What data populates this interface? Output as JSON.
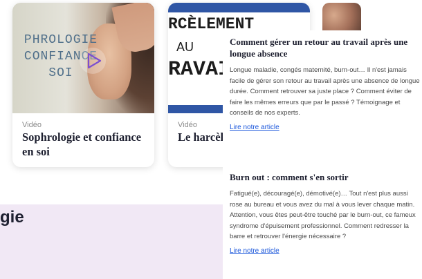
{
  "section": {
    "heading_fragment": "gie"
  },
  "cards": [
    {
      "thumbnail_text_lines": [
        "PHROLOGIE",
        "CONFIANCE",
        "SOI"
      ],
      "type": "Vidéo",
      "title": "Sophrologie et confiance en soi"
    },
    {
      "thumbnail_text_lines": [
        "RCÈLEMENT",
        "AU",
        "RAVAIL"
      ],
      "type": "Vidéo",
      "title": "Le harcèlement au travail"
    }
  ],
  "articles": [
    {
      "title": "Comment gérer un retour au travail après une longue absence",
      "body": "Longue maladie, congés maternité, burn-out… Il n'est jamais facile de gérer son retour au travail après une absence de longue durée. Comment retrouver sa juste place ? Comment éviter de faire les mêmes erreurs que par le passé ? Témoignage et conseils de nos experts.",
      "link": "Lire notre article"
    },
    {
      "title": "Burn out : comment s'en sortir",
      "body": "Fatigué(e), découragé(e), démotivé(e)… Tout n'est plus aussi rose au bureau et vous avez du mal à vous lever chaque matin. Attention, vous êtes peut-être touché par le burn-out, ce fameux syndrome d'épuisement professionnel. Comment redresser la barre et retrouver l'énergie nécessaire ?",
      "link": "Lire notre article"
    }
  ],
  "colors": {
    "link": "#1a56db",
    "heading": "#1e2030",
    "section_bg": "#f1e8f5",
    "band_blue": "#2f56a5"
  },
  "icons": {
    "play": "play-icon"
  }
}
